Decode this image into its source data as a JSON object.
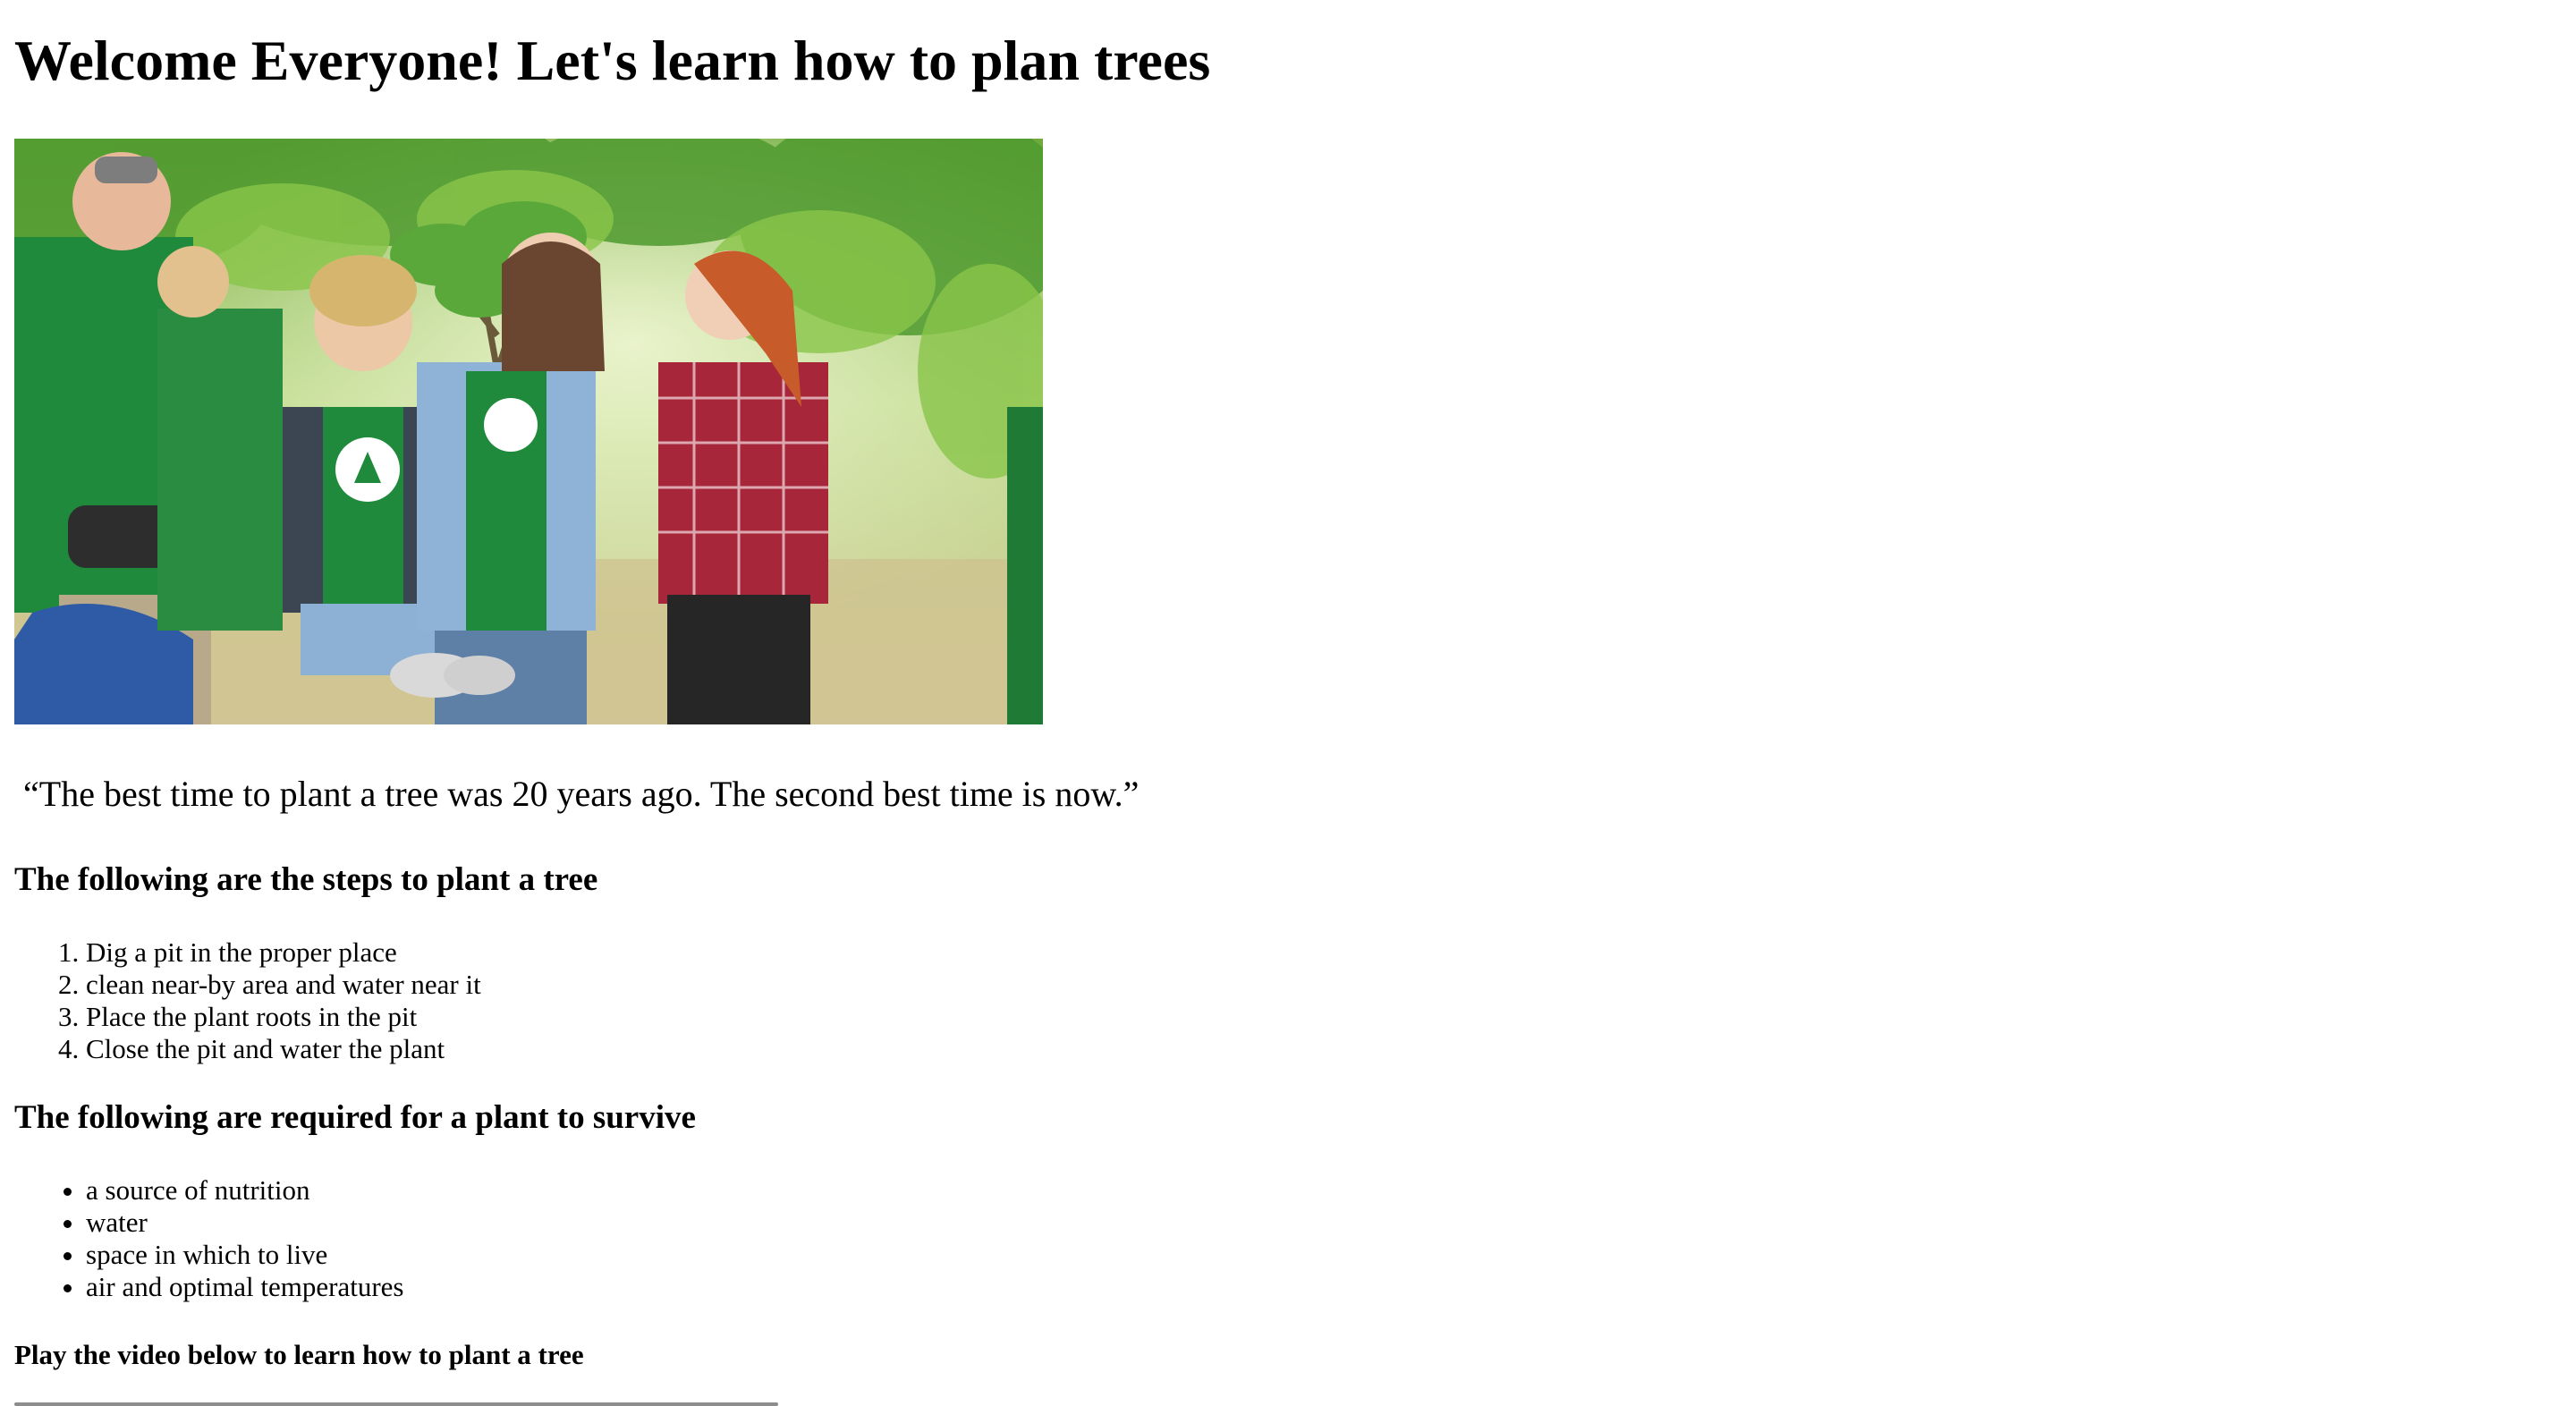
{
  "page": {
    "title": "Welcome Everyone! Let's learn how to plan trees",
    "image": {
      "description_icon": "tree-planting-photo"
    },
    "quote": "“The best time to plant a tree was 20 years ago. The second best time is now.”",
    "steps": {
      "heading": "The following are the steps to plant a tree",
      "items": [
        "Dig a pit in the proper place",
        "clean near-by area and water near it",
        "Place the plant roots in the pit",
        "Close the pit and water the plant"
      ]
    },
    "needs": {
      "heading": "The following are required for a plant to survive",
      "items": [
        "a source of nutrition",
        "water",
        "space in which to live",
        "air and optimal temperatures"
      ]
    },
    "video": {
      "heading": "Play the video below to learn how to plant a tree"
    }
  },
  "colors": {
    "text": "#000000",
    "background": "#ffffff",
    "shirt_green": "#1f7f3a",
    "foliage": "#8fc24f"
  }
}
